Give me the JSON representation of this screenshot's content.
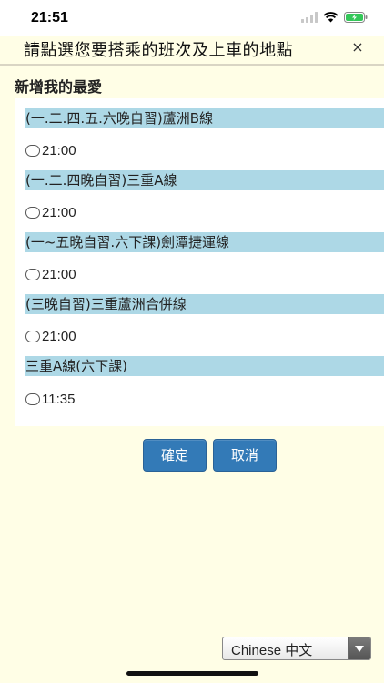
{
  "status_bar": {
    "time": "21:51",
    "icons": [
      "signal-icon",
      "wifi-icon",
      "battery-charging-icon"
    ]
  },
  "header": {
    "title": "請點選您要搭乘的班次及上車的地點",
    "close_label": "×"
  },
  "section": {
    "title": "新增我的最愛"
  },
  "routes": [
    {
      "name": "(一.二.四.五.六晚自習)蘆洲B線",
      "time": "21:00"
    },
    {
      "name": "(一.二.四晚自習)三重A線",
      "time": "21:00"
    },
    {
      "name": "(一~五晚自習.六下課)劍潭捷運線",
      "time": "21:00"
    },
    {
      "name": "(三晚自習)三重蘆洲合併線",
      "time": "21:00"
    },
    {
      "name": "三重A線(六下課)",
      "time": "11:35"
    }
  ],
  "actions": {
    "confirm_label": "確定",
    "cancel_label": "取消"
  },
  "language": {
    "selected": "Chinese 中文"
  },
  "colors": {
    "page_background": "#fffee6",
    "route_header": "#add8e6",
    "button": "#337ab7"
  }
}
